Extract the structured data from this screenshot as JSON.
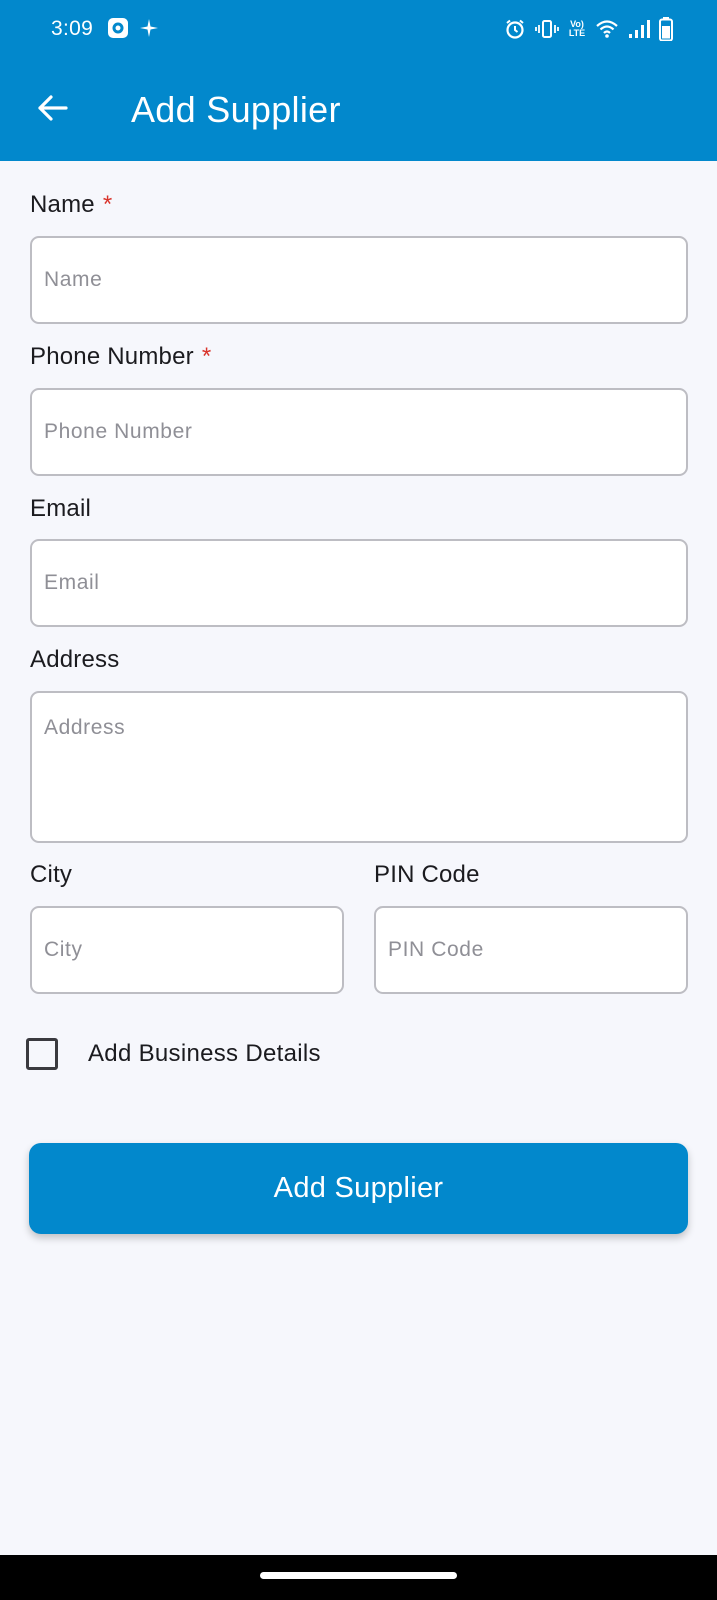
{
  "status_bar": {
    "time": "3:09",
    "network": "Vo) LTE"
  },
  "toolbar": {
    "title": "Add Supplier",
    "back_icon": "arrow-back-icon"
  },
  "form": {
    "name": {
      "label": "Name",
      "required_marker": "*",
      "placeholder": "Name"
    },
    "phone": {
      "label": "Phone Number",
      "required_marker": "*",
      "placeholder": "Phone Number"
    },
    "email": {
      "label": "Email",
      "placeholder": "Email"
    },
    "address": {
      "label": "Address",
      "placeholder": "Address"
    },
    "city": {
      "label": "City",
      "placeholder": "City"
    },
    "pin": {
      "label": "PIN Code",
      "placeholder": "PIN Code"
    },
    "business_details": {
      "label": "Add Business Details",
      "checked": false
    },
    "submit_label": "Add Supplier"
  },
  "colors": {
    "primary": "#0288cc",
    "required": "#d9342b",
    "background": "#f6f7fc"
  }
}
